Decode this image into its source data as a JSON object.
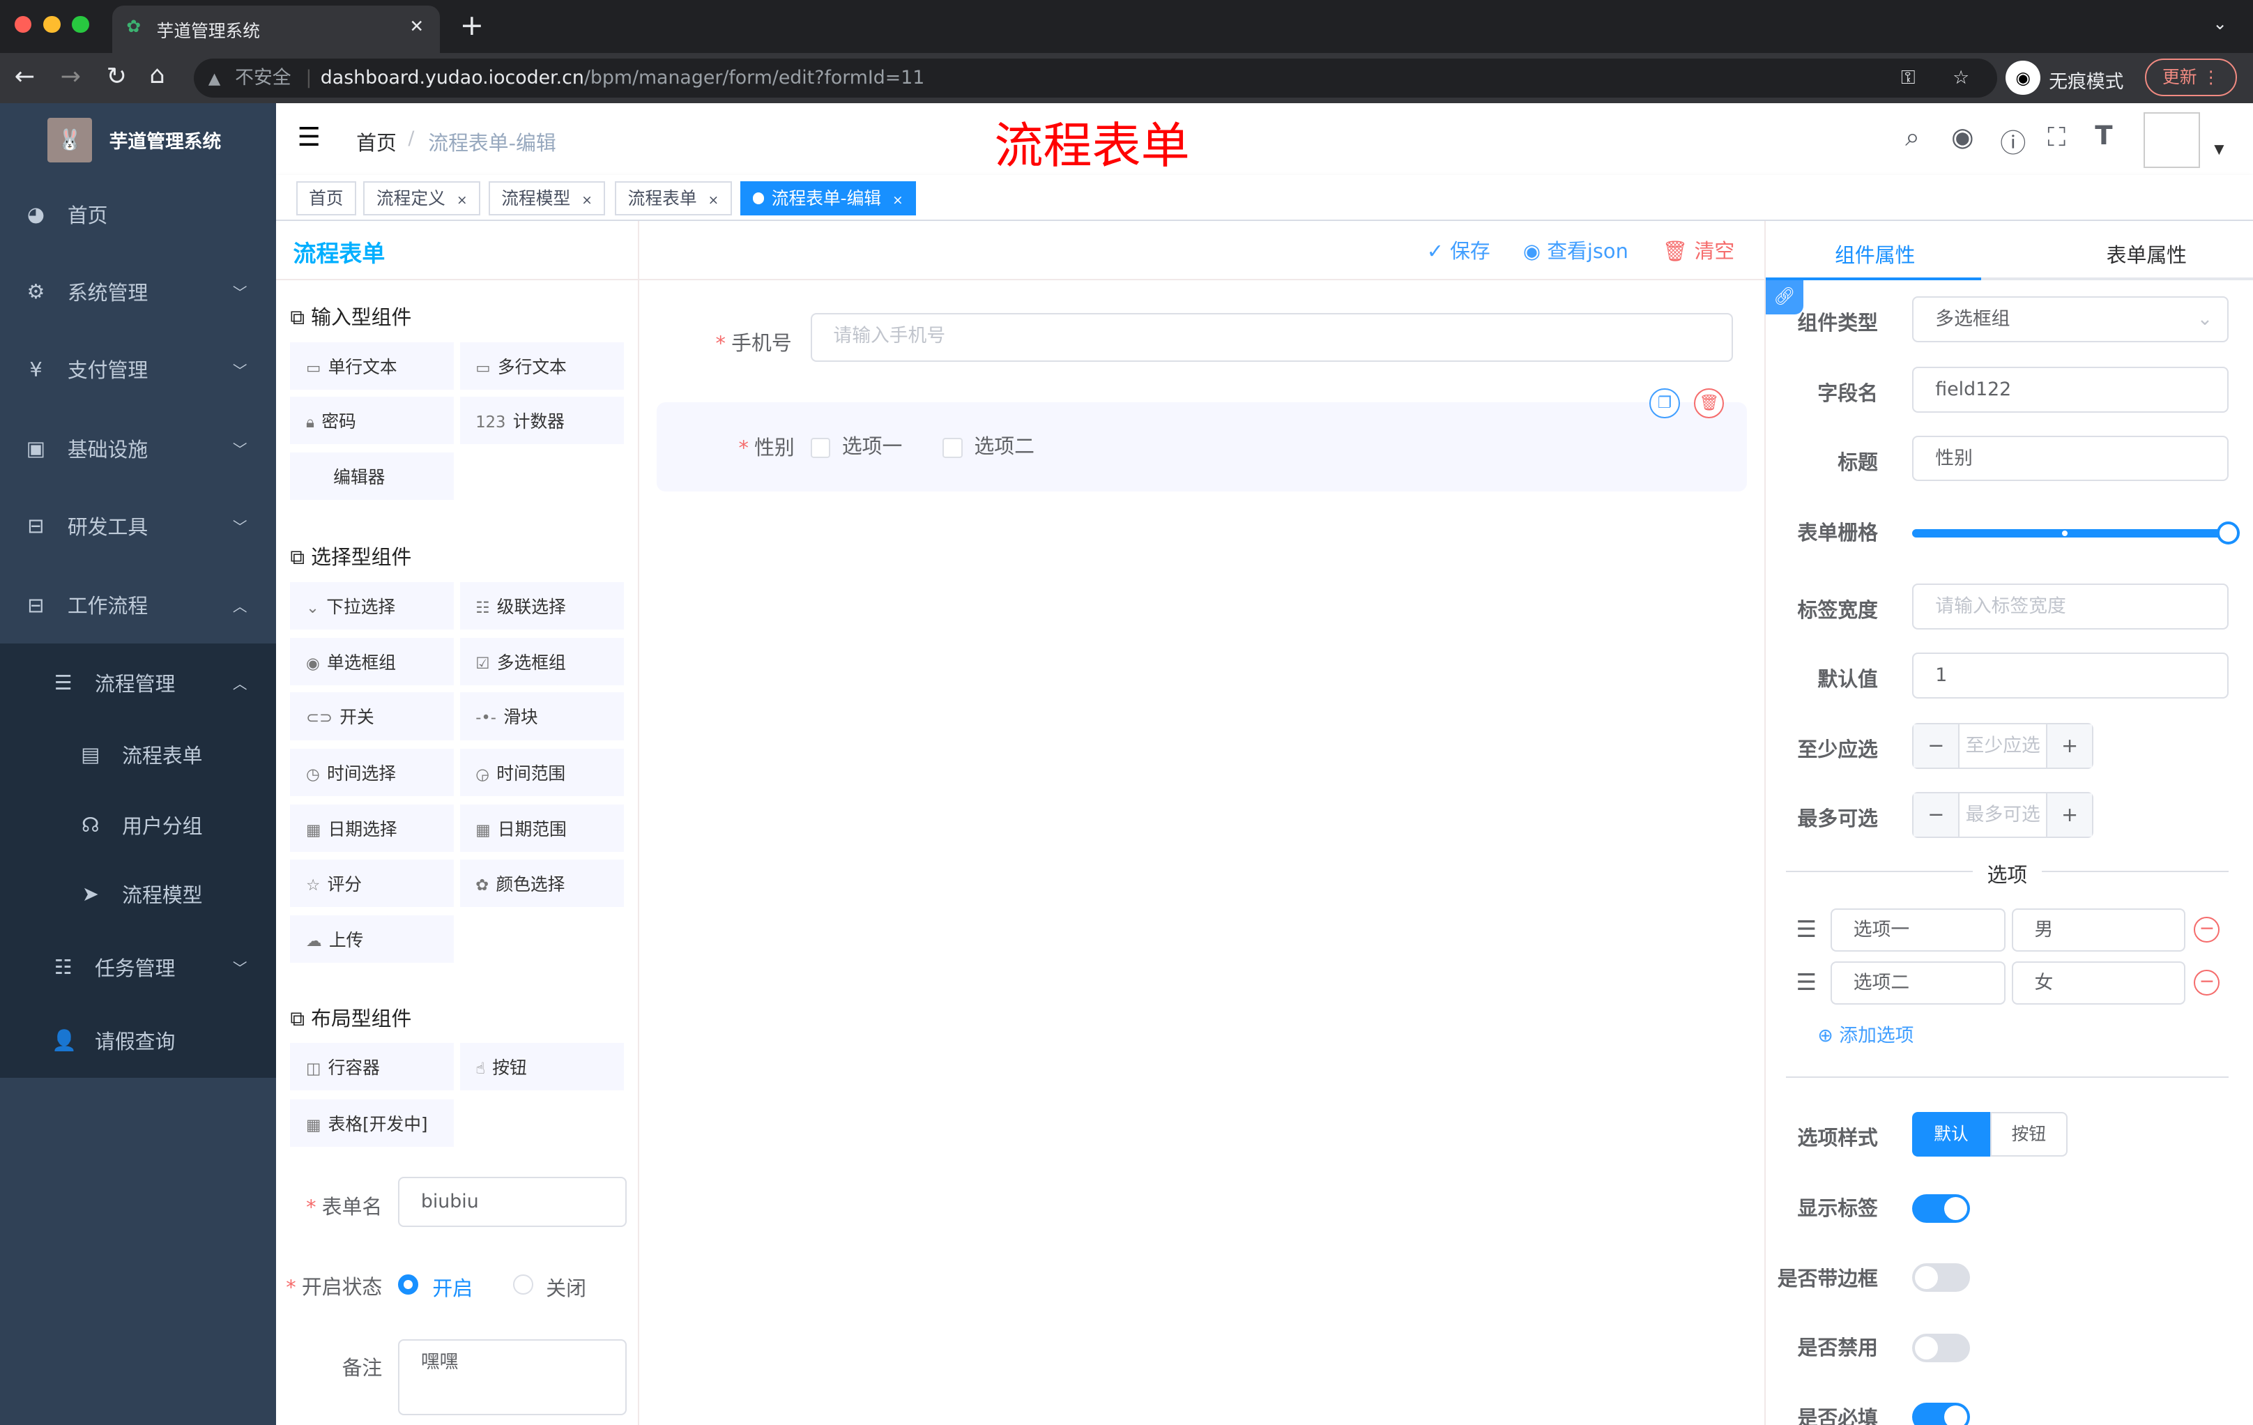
{
  "browser": {
    "tab_title": "芋道管理系统",
    "security": "不安全",
    "url_host": "dashboard.yudao.iocoder.cn",
    "url_path": "/bpm/manager/form/edit?formId=11",
    "incognito": "无痕模式",
    "update": "更新"
  },
  "sidebar": {
    "title": "芋道管理系统",
    "items": [
      {
        "label": "首页",
        "icon": "dashboard-icon"
      },
      {
        "label": "系统管理",
        "icon": "gear-icon"
      },
      {
        "label": "支付管理",
        "icon": "yen-icon"
      },
      {
        "label": "基础设施",
        "icon": "monitor-icon"
      },
      {
        "label": "研发工具",
        "icon": "toolbox-icon"
      },
      {
        "label": "工作流程",
        "icon": "toolbox-icon"
      },
      {
        "label": "流程管理",
        "icon": "tree-icon"
      },
      {
        "label": "流程表单",
        "icon": "form-icon"
      },
      {
        "label": "用户分组",
        "icon": "group-icon"
      },
      {
        "label": "流程模型",
        "icon": "send-icon"
      },
      {
        "label": "任务管理",
        "icon": "tree-icon"
      },
      {
        "label": "请假查询",
        "icon": "user-icon"
      }
    ]
  },
  "header": {
    "breadcrumb": [
      "首页",
      "流程表单-编辑"
    ],
    "overlay_title": "流程表单"
  },
  "tags": [
    {
      "label": "首页"
    },
    {
      "label": "流程定义"
    },
    {
      "label": "流程模型"
    },
    {
      "label": "流程表单"
    },
    {
      "label": "流程表单-编辑"
    }
  ],
  "left": {
    "logo": "流程表单",
    "groups": [
      "输入型组件",
      "选择型组件",
      "布局型组件"
    ],
    "input_components": [
      "单行文本",
      "多行文本",
      "密码",
      "计数器",
      "编辑器"
    ],
    "select_components": [
      "下拉选择",
      "级联选择",
      "单选框组",
      "多选框组",
      "开关",
      "滑块",
      "时间选择",
      "时间范围",
      "日期选择",
      "日期范围",
      "评分",
      "颜色选择",
      "上传"
    ],
    "layout_components": [
      "行容器",
      "按钮",
      "表格[开发中]"
    ],
    "form_name_label": "表单名",
    "form_name": "biubiu",
    "status_label": "开启状态",
    "status_on": "开启",
    "status_off": "关闭",
    "remark_label": "备注",
    "remark": "嘿嘿"
  },
  "toolbar": {
    "save": "保存",
    "view_json": "查看json",
    "clear": "清空"
  },
  "canvas": {
    "phone_label": "手机号",
    "phone_placeholder": "请输入手机号",
    "gender_label": "性别",
    "options": [
      "选项一",
      "选项二"
    ]
  },
  "right": {
    "tabs": [
      "组件属性",
      "表单属性"
    ],
    "component_type_label": "组件类型",
    "component_type": "多选框组",
    "field_label": "字段名",
    "field": "field122",
    "title_label": "标题",
    "title": "性别",
    "grid_label": "表单栅格",
    "grid_value": 24,
    "grid_max": 24,
    "label_width_label": "标签宽度",
    "label_width_placeholder": "请输入标签宽度",
    "default_label": "默认值",
    "default": "1",
    "min_label": "至少应选",
    "min_placeholder": "至少应选",
    "max_label": "最多可选",
    "max_placeholder": "最多可选",
    "options_divider": "选项",
    "options": [
      {
        "label": "选项一",
        "value": "男"
      },
      {
        "label": "选项二",
        "value": "女"
      }
    ],
    "add_option": "添加选项",
    "style_label": "选项样式",
    "styles": [
      "默认",
      "按钮"
    ],
    "show_label": "显示标签",
    "border_label": "是否带边框",
    "disabled_label": "是否禁用",
    "required_label": "是否必填",
    "switches": {
      "show_label": true,
      "border": false,
      "disabled": false,
      "required": true
    }
  },
  "colors": {
    "primary": "#1890ff",
    "sidebar": "#304156",
    "danger": "#f56c6c",
    "overlay": "#ff0000"
  }
}
